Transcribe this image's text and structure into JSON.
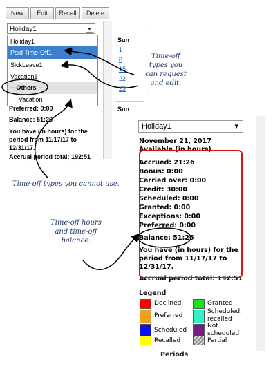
{
  "toolbar": {
    "new_label": "New",
    "edit_label": "Edit",
    "recall_label": "Recall",
    "delete_label": "Delete"
  },
  "dropdown1": {
    "value": "Holiday1",
    "arrow": "▼"
  },
  "dropdown_options": {
    "holiday": "Holiday1",
    "paid": "Paid Time-Off1",
    "sick": "SickLeave1",
    "vacation": "Vacation1",
    "others_header": "-- Others --",
    "vacation_other": "Vacation"
  },
  "calendar_bg": {
    "sun1": "Sun",
    "days": [
      "1",
      "8",
      "15",
      "22",
      "29"
    ],
    "sun2": "Sun"
  },
  "panel1_details": {
    "preferred": "Preferred: 0:00",
    "balance": "Balance: 51:26",
    "you_have": "You have (in hours) for the period from 11/17/17 to 12/31/17.",
    "accrual": "Accrual period total: 192:51"
  },
  "dropdown2": {
    "value": "Holiday1",
    "arrow": "▾"
  },
  "details": {
    "date": "November 21, 2017",
    "available": "Available (in hours)",
    "accrued": "Accrued: 21:26",
    "bonus": "Bonus: 0:00",
    "carried": "Carried over: 0:00",
    "credit": "Credit: 30:00",
    "scheduled": "Scheduled: 0:00",
    "granted": "Granted: 0:00",
    "exceptions": "Exceptions: 0:00",
    "preferred": "Preferred: 0:00",
    "balance": "Balance: 51:26",
    "you_have_1": "You have (in hours) for the",
    "you_have_2": "period from 11/17/17 to",
    "you_have_3": "12/31/17.",
    "accrual": "Accrual period total: 192:51",
    "cut_text": "Periods"
  },
  "legend": {
    "title": "Legend",
    "declined": "Declined",
    "granted": "Granted",
    "preferred": "Preferred",
    "scheduled_recalled_1": "Scheduled,",
    "scheduled_recalled_2": "recalled",
    "scheduled": "Scheduled",
    "not_scheduled_1": "Not",
    "not_scheduled_2": "scheduled",
    "recalled": "Recalled",
    "partial": "Partial"
  },
  "legend_colors": {
    "declined": "#ff0000",
    "granted": "#19e619",
    "preferred": "#f0a020",
    "scheduled_recalled": "#33f0c8",
    "scheduled": "#1010ee",
    "not_scheduled": "#7a1a8a",
    "recalled": "#ffff00",
    "partial": "#a0a0a0"
  },
  "callouts": {
    "types_request_1": "Time-off",
    "types_request_2": "types you",
    "types_request_3": "can request",
    "types_request_4": "and edit.",
    "types_cannot": "Time-off types you cannot use.",
    "hours_1": "Time-off hours",
    "hours_2": "and time-off",
    "hours_3": "balance."
  },
  "accent": {
    "selection": "#3d7fcf",
    "highlight_box": "#e01010",
    "annotation": "#1f3a6b"
  }
}
